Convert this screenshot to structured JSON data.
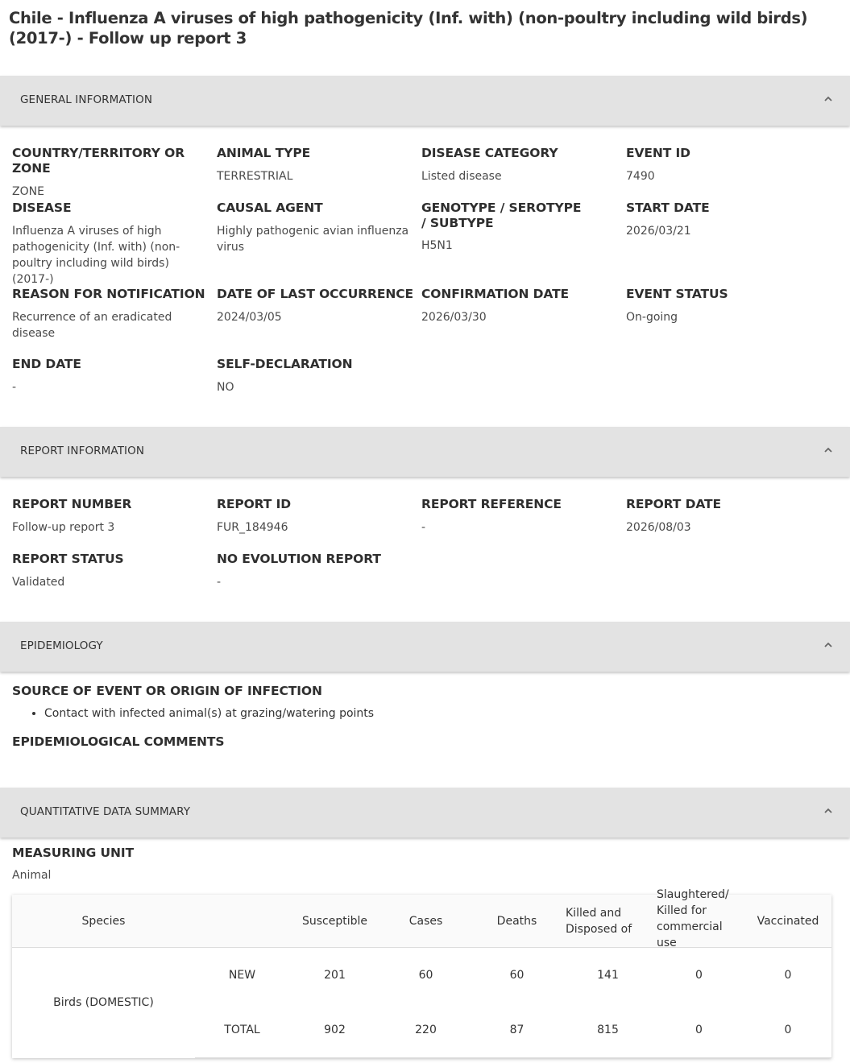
{
  "title": "Chile - Influenza A viruses of high pathogenicity (Inf. with) (non-poultry including wild birds) (2017-) - Follow up report 3",
  "sections": {
    "general": "GENERAL INFORMATION",
    "report": "REPORT INFORMATION",
    "epi": "EPIDEMIOLOGY",
    "quant": "QUANTITATIVE DATA SUMMARY"
  },
  "general": [
    {
      "label": "COUNTRY/TERRITORY OR ZONE",
      "value": "ZONE"
    },
    {
      "label": "ANIMAL TYPE",
      "value": "TERRESTRIAL"
    },
    {
      "label": "DISEASE CATEGORY",
      "value": "Listed disease"
    },
    {
      "label": "EVENT ID",
      "value": "7490"
    },
    {
      "label": "DISEASE",
      "value": "Influenza A viruses of high pathogenicity (Inf. with) (non-poultry including wild birds) (2017-)"
    },
    {
      "label": "CAUSAL AGENT",
      "value": "Highly pathogenic avian influenza virus"
    },
    {
      "label": "GENOTYPE / SEROTYPE / SUBTYPE",
      "value": "H5N1"
    },
    {
      "label": "START DATE",
      "value": "2026/03/21"
    },
    {
      "label": "REASON FOR NOTIFICATION",
      "value": "Recurrence of an eradicated disease"
    },
    {
      "label": "DATE OF LAST OCCURRENCE",
      "value": "2024/03/05"
    },
    {
      "label": "CONFIRMATION DATE",
      "value": "2026/03/30"
    },
    {
      "label": "EVENT STATUS",
      "value": "On-going"
    },
    {
      "label": "END DATE",
      "value": "-"
    },
    {
      "label": "SELF-DECLARATION",
      "value": "NO"
    }
  ],
  "report": [
    {
      "label": "REPORT NUMBER",
      "value": "Follow-up report 3"
    },
    {
      "label": "REPORT ID",
      "value": "FUR_184946"
    },
    {
      "label": "REPORT REFERENCE",
      "value": "-"
    },
    {
      "label": "REPORT DATE",
      "value": "2026/08/03"
    },
    {
      "label": "REPORT STATUS",
      "value": "Validated"
    },
    {
      "label": "NO EVOLUTION REPORT",
      "value": "-"
    }
  ],
  "epi": {
    "source_label": "SOURCE OF EVENT OR ORIGIN OF INFECTION",
    "sources": [
      "Contact with infected animal(s) at grazing/watering points"
    ],
    "comments_label": "EPIDEMIOLOGICAL COMMENTS"
  },
  "quant": {
    "unit_label": "MEASURING UNIT",
    "unit_value": "Animal",
    "headers": {
      "species": "Species",
      "susceptible": "Susceptible",
      "cases": "Cases",
      "deaths": "Deaths",
      "killed": "Killed and Disposed of",
      "slaughtered": "Slaughtered/ Killed for commercial use",
      "vaccinated": "Vaccinated"
    },
    "species": "Birds (DOMESTIC)",
    "rows": [
      {
        "type": "NEW",
        "susceptible": "201",
        "cases": "60",
        "deaths": "60",
        "killed": "141",
        "slaughtered": "0",
        "vaccinated": "0"
      },
      {
        "type": "TOTAL",
        "susceptible": "902",
        "cases": "220",
        "deaths": "87",
        "killed": "815",
        "slaughtered": "0",
        "vaccinated": "0"
      }
    ]
  }
}
